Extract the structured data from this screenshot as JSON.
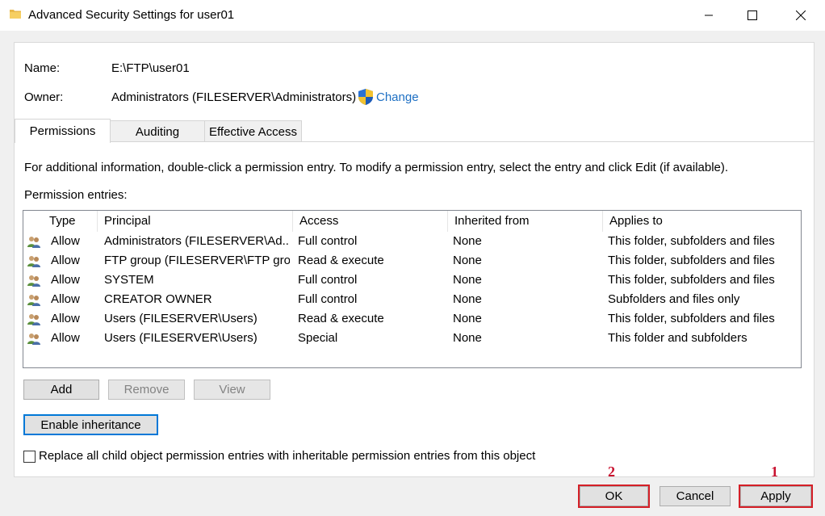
{
  "window": {
    "title": "Advanced Security Settings for user01"
  },
  "info": {
    "name_label": "Name:",
    "name_value": "E:\\FTP\\user01",
    "owner_label": "Owner:",
    "owner_value": "Administrators (FILESERVER\\Administrators)",
    "change_link": "Change"
  },
  "tabs": [
    {
      "label": "Permissions",
      "active": true
    },
    {
      "label": "Auditing",
      "active": false
    },
    {
      "label": "Effective Access",
      "active": false
    }
  ],
  "permissions": {
    "instruction": "For additional information, double-click a permission entry. To modify a permission entry, select the entry and click Edit (if available).",
    "entries_label": "Permission entries:",
    "columns": [
      "Type",
      "Principal",
      "Access",
      "Inherited from",
      "Applies to"
    ],
    "rows": [
      {
        "type": "Allow",
        "principal": "Administrators (FILESERVER\\Ad...",
        "access": "Full control",
        "inherited": "None",
        "applies": "This folder, subfolders and files"
      },
      {
        "type": "Allow",
        "principal": "FTP group (FILESERVER\\FTP grou...",
        "access": "Read & execute",
        "inherited": "None",
        "applies": "This folder, subfolders and files"
      },
      {
        "type": "Allow",
        "principal": "SYSTEM",
        "access": "Full control",
        "inherited": "None",
        "applies": "This folder, subfolders and files"
      },
      {
        "type": "Allow",
        "principal": "CREATOR OWNER",
        "access": "Full control",
        "inherited": "None",
        "applies": "Subfolders and files only"
      },
      {
        "type": "Allow",
        "principal": "Users (FILESERVER\\Users)",
        "access": "Read & execute",
        "inherited": "None",
        "applies": "This folder, subfolders and files"
      },
      {
        "type": "Allow",
        "principal": "Users (FILESERVER\\Users)",
        "access": "Special",
        "inherited": "None",
        "applies": "This folder and subfolders"
      }
    ],
    "add_button": "Add",
    "remove_button": "Remove",
    "view_button": "View",
    "enable_inheritance_button": "Enable inheritance",
    "replace_checkbox_label": "Replace all child object permission entries with inheritable permission entries from this object",
    "replace_checked": false
  },
  "footer": {
    "ok": "OK",
    "cancel": "Cancel",
    "apply": "Apply"
  },
  "annotations": {
    "ok_marker": "2",
    "apply_marker": "1",
    "marker_color": "#d51f27"
  },
  "icons": {
    "folder": "folder-icon",
    "shield": "uac-shield-icon",
    "user_group": "user-group-icon"
  }
}
